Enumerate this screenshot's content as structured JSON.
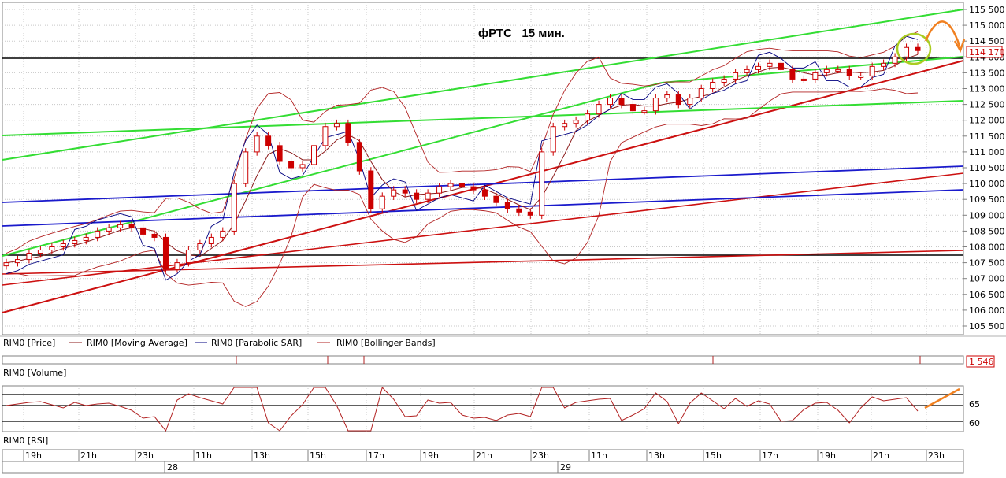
{
  "chart_title": "фРТС   15 мин.",
  "price_panel": {
    "yticks": [
      "115 500",
      "115 000",
      "114 500",
      "114 000",
      "113 500",
      "113 000",
      "112 500",
      "112 000",
      "111 500",
      "111 000",
      "110 500",
      "110 000",
      "109 500",
      "109 000",
      "108 500",
      "108 000",
      "107 500",
      "107 000",
      "106 500",
      "106 000",
      "105 500"
    ],
    "current_price_label": "114 170",
    "legend": [
      {
        "text": "RIM0 [Price]",
        "color": "#cc0000"
      },
      {
        "text": "RIM0 [Moving Average]",
        "color": "#8b1a1a"
      },
      {
        "text": "RIM0 [Parabolic SAR]",
        "color": "#000080"
      },
      {
        "text": "RIM0 [Bollinger Bands]",
        "color": "#b22222"
      }
    ]
  },
  "volume_panel": {
    "label": "RIM0 [Volume]",
    "value_label": "1 546"
  },
  "rsi_panel": {
    "label": "RIM0 [RSI]",
    "yticks": [
      "65",
      "60"
    ]
  },
  "time_axis": {
    "hours": [
      "19h",
      "21h",
      "23h",
      "11h",
      "13h",
      "15h",
      "17h",
      "19h",
      "21h",
      "23h",
      "11h",
      "13h",
      "15h",
      "17h",
      "19h",
      "21h",
      "23h"
    ],
    "days": [
      "28",
      "29"
    ]
  },
  "chart_data": {
    "type": "candlestick",
    "title": "фРТС   15 мин.",
    "ylim": [
      105300,
      115650
    ],
    "grid": true,
    "series_names": [
      "RIM0 [Price]",
      "RIM0 [Moving Average]",
      "RIM0 [Parabolic SAR]",
      "RIM0 [Bollinger Bands]"
    ],
    "price_close_path": [
      107500,
      107600,
      107800,
      107900,
      108000,
      108100,
      108200,
      108300,
      108500,
      108600,
      108700,
      108600,
      108400,
      108300,
      107300,
      107500,
      107900,
      108100,
      108300,
      108500,
      110000,
      111000,
      111500,
      111200,
      110700,
      110500,
      110600,
      111200,
      111800,
      111900,
      111300,
      110400,
      109200,
      109600,
      109800,
      109700,
      109500,
      109700,
      109900,
      110000,
      109900,
      109800,
      109600,
      109400,
      109200,
      109100,
      109000,
      111000,
      111800,
      111900,
      112000,
      112200,
      112500,
      112700,
      112500,
      112300,
      112300,
      112700,
      112800,
      112500,
      112700,
      113000,
      113200,
      113300,
      113500,
      113600,
      113700,
      113800,
      113600,
      113300,
      113300,
      113500,
      113600,
      113600,
      113400,
      113400,
      113700,
      113800,
      114000,
      114300,
      114200
    ],
    "rsi_levels": [
      65,
      60
    ]
  }
}
